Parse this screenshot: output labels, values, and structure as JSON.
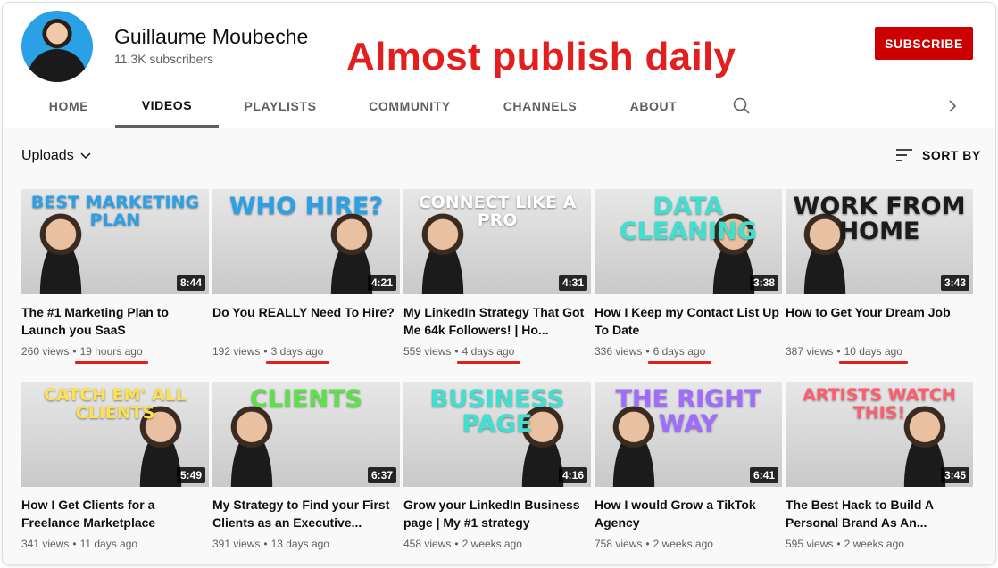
{
  "channel": {
    "name": "Guillaume Moubeche",
    "subscribers": "11.3K subscribers",
    "subscribe_label": "SUBSCRIBE"
  },
  "annotation": "Almost publish daily",
  "tabs": [
    {
      "label": "HOME",
      "active": false
    },
    {
      "label": "VIDEOS",
      "active": true
    },
    {
      "label": "PLAYLISTS",
      "active": false
    },
    {
      "label": "COMMUNITY",
      "active": false
    },
    {
      "label": "CHANNELS",
      "active": false
    },
    {
      "label": "ABOUT",
      "active": false
    }
  ],
  "icons": {
    "search": "search-icon",
    "next": "chevron-right-icon",
    "sort": "sort-icon",
    "dropdown": "chevron-down-icon"
  },
  "uploads_label": "Uploads",
  "sort_label": "SORT BY",
  "colors": {
    "accent": "#cc0000",
    "annotation": "#e31e1e"
  },
  "videos": [
    {
      "thumb_text": "BEST MARKETING PLAN",
      "thumb_color": "#2aa0e6",
      "duration": "8:44",
      "title": "The #1 Marketing Plan to Launch you SaaS",
      "views": "260 views",
      "age": "19 hours ago",
      "highlighted": true
    },
    {
      "thumb_text": "WHO HIRE?",
      "thumb_color": "#2aa0e6",
      "duration": "4:21",
      "title": "Do You REALLY Need To Hire?",
      "views": "192 views",
      "age": "3 days ago",
      "highlighted": true
    },
    {
      "thumb_text": "CONNECT LIKE A PRO",
      "thumb_color": "#ffffff",
      "duration": "4:31",
      "title": "My LinkedIn Strategy That Got Me 64k Followers! | Ho...",
      "views": "559 views",
      "age": "4 days ago",
      "highlighted": true
    },
    {
      "thumb_text": "DATA CLEANING",
      "thumb_color": "#3fe0d0",
      "duration": "3:38",
      "title": "How I Keep my Contact List Up To Date",
      "views": "336 views",
      "age": "6 days ago",
      "highlighted": true
    },
    {
      "thumb_text": "WORK FROM HOME",
      "thumb_color": "#1b1b1b",
      "duration": "3:43",
      "title": "How to Get Your Dream Job",
      "views": "387 views",
      "age": "10 days ago",
      "highlighted": true
    },
    {
      "thumb_text": "CATCH EM' ALL CLIENTS",
      "thumb_color": "#ffe14a",
      "duration": "5:49",
      "title": "How I Get Clients for a Freelance Marketplace",
      "views": "341 views",
      "age": "11 days ago",
      "highlighted": false
    },
    {
      "thumb_text": "CLIENTS",
      "thumb_color": "#5ee04a",
      "duration": "6:37",
      "title": "My Strategy to Find your First Clients as an Executive...",
      "views": "391 views",
      "age": "13 days ago",
      "highlighted": false
    },
    {
      "thumb_text": "BUSINESS PAGE",
      "thumb_color": "#3fe0d0",
      "duration": "4:16",
      "title": "Grow your LinkedIn Business page | My #1 strategy",
      "views": "458 views",
      "age": "2 weeks ago",
      "highlighted": false
    },
    {
      "thumb_text": "THE RIGHT WAY",
      "thumb_color": "#a06bff",
      "duration": "6:41",
      "title": "How I would Grow a TikTok Agency",
      "views": "758 views",
      "age": "2 weeks ago",
      "highlighted": false
    },
    {
      "thumb_text": "ARTISTS WATCH THIS!",
      "thumb_color": "#ff5d6e",
      "duration": "3:45",
      "title": "The Best Hack to Build A Personal Brand As An...",
      "views": "595 views",
      "age": "2 weeks ago",
      "highlighted": false
    }
  ]
}
